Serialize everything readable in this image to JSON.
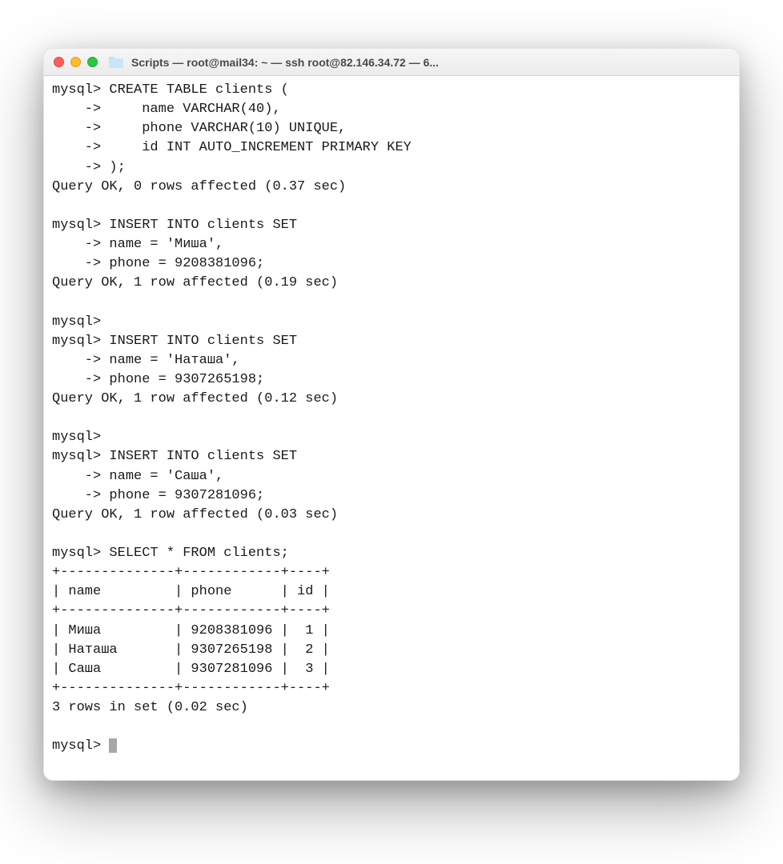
{
  "window": {
    "title": "Scripts — root@mail34: ~ — ssh root@82.146.34.72 — 6...",
    "traffic_lights": [
      "close",
      "minimize",
      "zoom"
    ]
  },
  "terminal": {
    "lines": [
      "mysql> CREATE TABLE clients (",
      "    ->     name VARCHAR(40),",
      "    ->     phone VARCHAR(10) UNIQUE,",
      "    ->     id INT AUTO_INCREMENT PRIMARY KEY",
      "    -> );",
      "Query OK, 0 rows affected (0.37 sec)",
      "",
      "mysql> INSERT INTO clients SET",
      "    -> name = 'Миша',",
      "    -> phone = 9208381096;",
      "Query OK, 1 row affected (0.19 sec)",
      "",
      "mysql>",
      "mysql> INSERT INTO clients SET",
      "    -> name = 'Наташа',",
      "    -> phone = 9307265198;",
      "Query OK, 1 row affected (0.12 sec)",
      "",
      "mysql>",
      "mysql> INSERT INTO clients SET",
      "    -> name = 'Саша',",
      "    -> phone = 9307281096;",
      "Query OK, 1 row affected (0.03 sec)",
      "",
      "mysql> SELECT * FROM clients;",
      "+--------------+------------+----+",
      "| name         | phone      | id |",
      "+--------------+------------+----+",
      "| Миша         | 9208381096 |  1 |",
      "| Наташа       | 9307265198 |  2 |",
      "| Саша         | 9307281096 |  3 |",
      "+--------------+------------+----+",
      "3 rows in set (0.02 sec)",
      ""
    ],
    "prompt_final": "mysql> "
  }
}
